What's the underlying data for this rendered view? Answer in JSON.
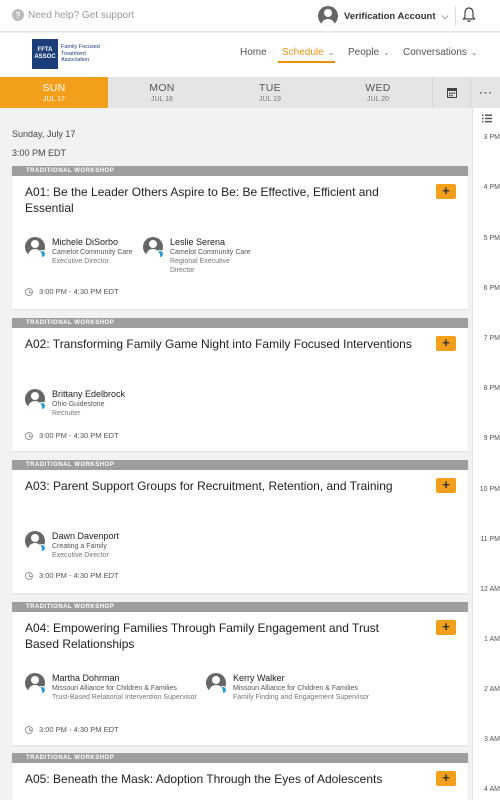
{
  "topbar": {
    "help": "Need help? Get support",
    "account": "Verification Account"
  },
  "nav": {
    "home": "Home",
    "schedule": "Schedule",
    "people": "People",
    "conversations": "Conversations"
  },
  "logo": {
    "mark_top": "FFTA",
    "mark_bottom": "ASSOC",
    "text": "Family Focused Treatment Association"
  },
  "days": [
    {
      "name": "SUN",
      "date": "JUL 17"
    },
    {
      "name": "MON",
      "date": "JUL 18"
    },
    {
      "name": "TUE",
      "date": "JUL 19"
    },
    {
      "name": "WED",
      "date": "JUL 20"
    }
  ],
  "schedule": {
    "date": "Sunday, July 17",
    "time": "3:00 PM EDT"
  },
  "rail": {
    "hours": [
      "3 PM",
      "4 PM",
      "5 PM",
      "6 PM",
      "7 PM",
      "8 PM",
      "9 PM",
      "10 PM",
      "11 PM",
      "12 AM",
      "1 AM",
      "2 AM",
      "3 AM",
      "4 AM"
    ]
  },
  "sessions": [
    {
      "tag": "TRADITIONAL WORKSHOP",
      "title": "A01: Be the Leader Others Aspire to Be: Be Effective, Efficient and Essential",
      "time": "3:00 PM - 4:30 PM EDT",
      "speakers": [
        {
          "name": "Michele DiSorbo",
          "org": "Camelot Community Care",
          "role": "Executive Director"
        },
        {
          "name": "Leslie Serena",
          "org": "Camelot Community Care",
          "role": "Regional Executive Director"
        }
      ]
    },
    {
      "tag": "TRADITIONAL WORKSHOP",
      "title": "A02: Transforming Family Game Night into Family Focused Interventions",
      "time": "3:00 PM - 4:30 PM EDT",
      "speakers": [
        {
          "name": "Brittany Edelbrock",
          "org": "Ohio Guidestone",
          "role": "Recruiter"
        }
      ]
    },
    {
      "tag": "TRADITIONAL WORKSHOP",
      "title": "A03: Parent Support Groups for Recruitment, Retention, and Training",
      "time": "3:00 PM - 4:30 PM EDT",
      "speakers": [
        {
          "name": "Dawn Davenport",
          "org": "Creating a Family",
          "role": "Executive Director"
        }
      ]
    },
    {
      "tag": "TRADITIONAL WORKSHOP",
      "title": "A04: Empowering Families Through Family Engagement and Trust Based Relationships",
      "time": "3:00 PM - 4:30 PM EDT",
      "speakers": [
        {
          "name": "Martha Dohrman",
          "org": "Missouri Alliance for Children & Families",
          "role": "Trust-Based Relational Intervention Supervisor"
        },
        {
          "name": "Kerry Walker",
          "org": "Missouri Alliance for Children & Families",
          "role": "Family Finding and Engagement Supervisor"
        }
      ]
    },
    {
      "tag": "TRADITIONAL WORKSHOP",
      "title": "A05: Beneath the Mask: Adoption Through the Eyes of Adolescents",
      "time": "",
      "speakers": []
    }
  ],
  "add_label": "+"
}
